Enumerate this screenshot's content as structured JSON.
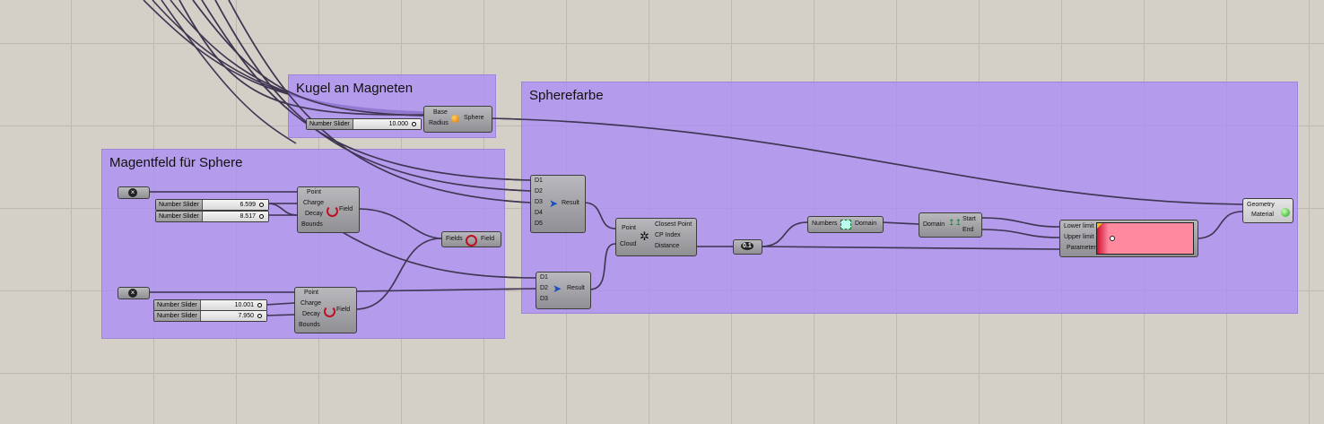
{
  "groups": {
    "kugel": "Kugel an Magneten",
    "spherefarbe": "Spherefarbe",
    "magnetfeld": "Magentfeld für Sphere"
  },
  "sphere": {
    "inputs": [
      "Base",
      "Radius"
    ],
    "output": "Sphere"
  },
  "sliders": [
    {
      "name": "Number Slider",
      "value": "10.000"
    },
    {
      "name": "Number Slider",
      "value": "6.599"
    },
    {
      "name": "Number Slider",
      "value": "8.517"
    },
    {
      "name": "Number Slider",
      "value": "10.001"
    },
    {
      "name": "Number Slider",
      "value": "7.950"
    }
  ],
  "point_charge": {
    "inputs": [
      "Point",
      "Charge",
      "Decay",
      "Bounds"
    ],
    "output": "Field"
  },
  "merge_fields": {
    "input": "Fields",
    "output": "Field"
  },
  "merge1": {
    "inputs": [
      "D1",
      "D2",
      "D3",
      "D4",
      "D5"
    ],
    "output": "Result"
  },
  "merge2": {
    "inputs": [
      "D1",
      "D2",
      "D3"
    ],
    "output": "Result"
  },
  "closest_point": {
    "inputs": [
      "Point",
      "Cloud"
    ],
    "outputs": [
      "Closest Point",
      "CP Index",
      "Distance"
    ]
  },
  "number_param": {
    "value": "0.1"
  },
  "bounds": {
    "input": "Numbers",
    "output": "Domain"
  },
  "deconstruct_domain": {
    "input": "Domain",
    "outputs": [
      "Start",
      "End"
    ]
  },
  "gradient": {
    "inputs": [
      "Lower limit",
      "Upper limit",
      "Parameter"
    ],
    "color": "#ff8aa0"
  },
  "custom_preview": {
    "inputs": [
      "Geometry",
      "Material"
    ]
  },
  "colors": {
    "canvas": "#d4d0c8",
    "group": "#b49ee9",
    "wire": "#4a3f66"
  }
}
